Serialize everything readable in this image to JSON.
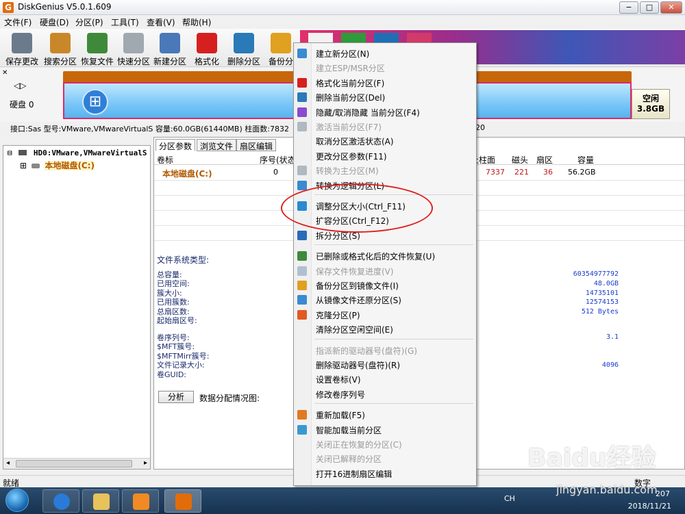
{
  "window": {
    "title": "DiskGenius V5.0.1.609",
    "app_icon_letter": "G",
    "controls": [
      "−",
      "□",
      "✕"
    ]
  },
  "menubar": [
    "文件(F)",
    "硬盘(D)",
    "分区(P)",
    "工具(T)",
    "查看(V)",
    "帮助(H)"
  ],
  "toolbar": [
    {
      "label": "保存更改",
      "icon": "save-icon",
      "color": "#6b7b8c"
    },
    {
      "label": "搜索分区",
      "icon": "magnifier-icon",
      "color": "#c8882a"
    },
    {
      "label": "恢复文件",
      "icon": "recover-box-icon",
      "color": "#3f8a3a"
    },
    {
      "label": "快速分区",
      "icon": "disc-icon",
      "color": "#a0a8b0"
    },
    {
      "label": "新建分区",
      "icon": "new-partition-icon",
      "color": "#4a78b8"
    },
    {
      "label": "格式化",
      "icon": "format-icon",
      "color": "#d62020"
    },
    {
      "label": "删除分区",
      "icon": "trash-icon",
      "color": "#2a7ab8"
    },
    {
      "label": "备份分",
      "icon": "backup-pie-icon",
      "color": "#e0a020"
    }
  ],
  "disk": {
    "nav": "◁▷",
    "label": "硬盘 0",
    "free_title": "空闲",
    "free_size": "3.8GB",
    "info": "接口:Sas  型号:VMware,VMwareVirtualS  容量:60.0GB(61440MB)  柱面数:7832",
    "info_tail": "20"
  },
  "tree": {
    "root": "HD0:VMware,VMwareVirtualS",
    "child": "本地磁盘(C:)",
    "expand_minus": "⊟",
    "expand_plus": "⊞"
  },
  "tabs": [
    "分区参数",
    "浏览文件",
    "扇区编辑"
  ],
  "partition_table": {
    "headers": [
      "卷标",
      "序号(状态",
      "止柱面",
      "磁头",
      "扇区",
      "容量"
    ],
    "row": {
      "label": "本地磁盘(C:)",
      "index": "0",
      "end_cyl": "7337",
      "head": "221",
      "sector": "36",
      "size": "56.2GB"
    }
  },
  "details": {
    "fs_type_label": "文件系统类型:",
    "group1_labels": [
      "总容量:",
      "已用空间:",
      "簇大小:",
      "已用簇数:",
      "总扇区数:",
      "起始扇区号:"
    ],
    "group1_values": [
      "60354977792",
      "48.0GB",
      "14735101",
      "12574153",
      "512 Bytes"
    ],
    "group2_labels": [
      "卷序列号:",
      "$MFT簇号:",
      "$MFTMirr簇号:",
      "文件记录大小:",
      "卷GUID:"
    ],
    "group2_values": [
      "3.1",
      "4096"
    ],
    "analyze_button": "分析",
    "alloc_label": "数据分配情况图:"
  },
  "status": {
    "text": "就绪",
    "num": "数字"
  },
  "context_menu": [
    {
      "label": "建立新分区(N)",
      "icon": "new-partition-icon",
      "color": "#3a8ad0",
      "disabled": false
    },
    {
      "label": "建立ESP/MSR分区",
      "icon": "",
      "color": "",
      "disabled": true
    },
    {
      "label": "格式化当前分区(F)",
      "icon": "format-icon",
      "color": "#d62020",
      "disabled": false
    },
    {
      "label": "删除当前分区(Del)",
      "icon": "trash-icon",
      "color": "#2a7ab8",
      "disabled": false
    },
    {
      "label": "隐藏/取消隐藏 当前分区(F4)",
      "icon": "hide-icon",
      "color": "#8a4ad0",
      "disabled": false
    },
    {
      "label": "激活当前分区(F7)",
      "icon": "activate-icon",
      "color": "#b0b8c0",
      "disabled": true
    },
    {
      "label": "取消分区激活状态(A)",
      "icon": "",
      "color": "",
      "disabled": false
    },
    {
      "label": "更改分区参数(F11)",
      "icon": "",
      "color": "",
      "disabled": false
    },
    {
      "label": "转换为主分区(M)",
      "icon": "convert-icon",
      "color": "#b0b8c0",
      "disabled": true
    },
    {
      "label": "转换为逻辑分区(L)",
      "icon": "convert-logical-icon",
      "color": "#3a8ad0",
      "disabled": false
    },
    {
      "sep": true
    },
    {
      "label": "调整分区大小(Ctrl_F11)",
      "icon": "resize-icon",
      "color": "#2a8ad0",
      "disabled": false
    },
    {
      "label": "扩容分区(Ctrl_F12)",
      "icon": "",
      "color": "",
      "disabled": false
    },
    {
      "label": "拆分分区(S)",
      "icon": "split-icon",
      "color": "#2a6ab8",
      "disabled": false
    },
    {
      "sep": true
    },
    {
      "label": "已删除或格式化后的文件恢复(U)",
      "icon": "recover-box-icon",
      "color": "#3f8a3a",
      "disabled": false
    },
    {
      "label": "保存文件恢复进度(V)",
      "icon": "save-progress-icon",
      "color": "#b0c0d0",
      "disabled": true
    },
    {
      "label": "备份分区到镜像文件(I)",
      "icon": "backup-pie-icon",
      "color": "#e0a020",
      "disabled": false
    },
    {
      "label": "从镜像文件还原分区(S)",
      "icon": "restore-icon",
      "color": "#3a8ad0",
      "disabled": false
    },
    {
      "label": "克隆分区(P)",
      "icon": "clone-icon",
      "color": "#e05a20",
      "disabled": false
    },
    {
      "label": "清除分区空闲空间(E)",
      "icon": "",
      "color": "",
      "disabled": false
    },
    {
      "sep": true
    },
    {
      "label": "指派新的驱动器号(盘符)(G)",
      "icon": "",
      "color": "",
      "disabled": true
    },
    {
      "label": "删除驱动器号(盘符)(R)",
      "icon": "",
      "color": "",
      "disabled": false
    },
    {
      "label": "设置卷标(V)",
      "icon": "",
      "color": "",
      "disabled": false
    },
    {
      "label": "修改卷序列号",
      "icon": "",
      "color": "",
      "disabled": false
    },
    {
      "sep": true
    },
    {
      "label": "重新加载(F5)",
      "icon": "reload-icon",
      "color": "#e07a20",
      "disabled": false
    },
    {
      "label": "智能加载当前分区",
      "icon": "smart-load-icon",
      "color": "#3a9ad0",
      "disabled": false
    },
    {
      "label": "关闭正在恢复的分区(C)",
      "icon": "",
      "color": "",
      "disabled": true
    },
    {
      "label": "关闭已解释的分区",
      "icon": "",
      "color": "",
      "disabled": true
    },
    {
      "label": "打开16进制扇区编辑",
      "icon": "",
      "color": "",
      "disabled": false
    }
  ],
  "taskbar": {
    "lang": "CH",
    "time": "207",
    "date": "2018/11/21"
  },
  "watermark": {
    "main": "Baidu经验",
    "sub": "jingyan.baidu.com"
  }
}
